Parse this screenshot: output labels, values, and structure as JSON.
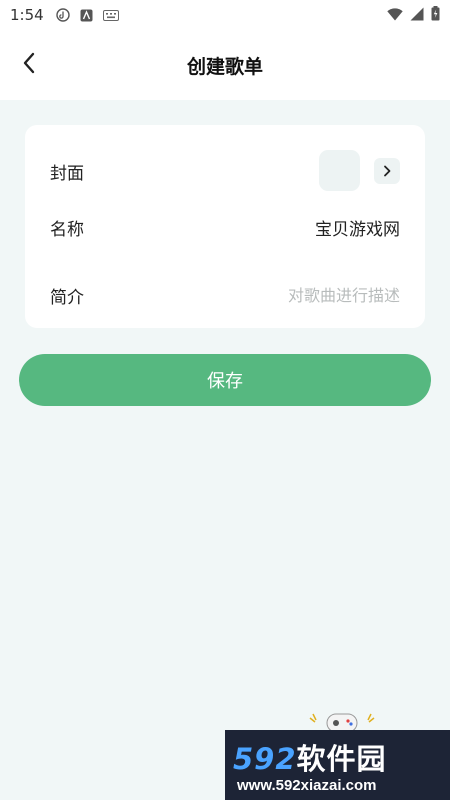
{
  "status_bar": {
    "time": "1:54",
    "icons_left": [
      "tiktok-icon",
      "android-icon",
      "keyboard-icon"
    ],
    "icons_right": [
      "wifi-icon",
      "signal-icon",
      "battery-icon"
    ]
  },
  "header": {
    "title": "创建歌单",
    "back_icon": "chevron-left-icon"
  },
  "form": {
    "cover_label": "封面",
    "name_label": "名称",
    "name_value": "宝贝游戏网",
    "intro_label": "简介",
    "intro_placeholder": "对歌曲进行描述"
  },
  "save_label": "保存",
  "watermark": {
    "brand_number": "592",
    "brand_text": "软件园",
    "url": "www.592xiazai.com"
  },
  "colors": {
    "accent": "#56b880",
    "background": "#f1f7f7",
    "card": "#ffffff"
  }
}
